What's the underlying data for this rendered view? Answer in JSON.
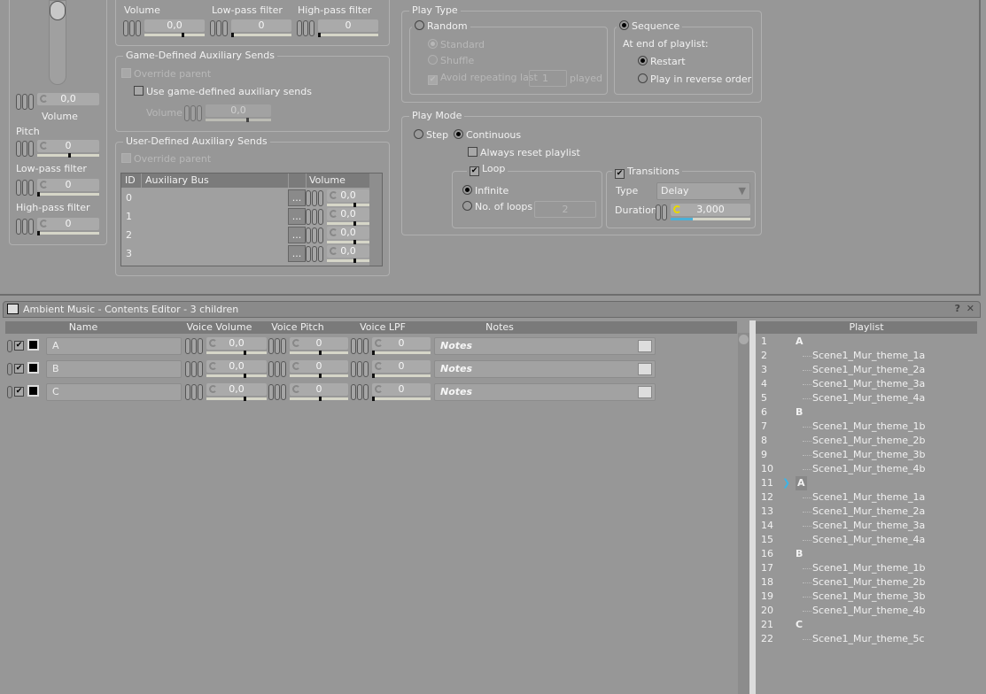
{
  "left_column": {
    "volume_value": "0,0",
    "volume_label": "Volume",
    "pitch_label": "Pitch",
    "pitch_value": "0",
    "lpf_label": "Low-pass filter",
    "lpf_value": "0",
    "hpf_label": "High-pass filter",
    "hpf_value": "0"
  },
  "output": {
    "volume_label": "Volume",
    "volume_value": "0,0",
    "lpf_label": "Low-pass filter",
    "lpf_value": "0",
    "hpf_label": "High-pass filter",
    "hpf_value": "0"
  },
  "game_aux": {
    "title": "Game-Defined Auxiliary Sends",
    "override": "Override parent",
    "use_label": "Use game-defined auxiliary sends",
    "volume_label": "Volume",
    "volume_value": "0,0"
  },
  "user_aux": {
    "title": "User-Defined Auxiliary Sends",
    "override": "Override parent",
    "columns": [
      "ID",
      "Auxiliary Bus",
      "",
      "Volume"
    ],
    "rows": [
      {
        "id": "0",
        "bus": "",
        "volume": "0,0"
      },
      {
        "id": "1",
        "bus": "",
        "volume": "0,0"
      },
      {
        "id": "2",
        "bus": "",
        "volume": "0,0"
      },
      {
        "id": "3",
        "bus": "",
        "volume": "0,0"
      }
    ],
    "browse_label": "..."
  },
  "play_type": {
    "title": "Play Type",
    "random": "Random",
    "standard": "Standard",
    "shuffle": "Shuffle",
    "avoid": "Avoid repeating last",
    "avoid_value": "1",
    "played": "played",
    "sequence": "Sequence",
    "at_end": "At end of playlist:",
    "restart": "Restart",
    "reverse": "Play in reverse order",
    "selected": "Sequence"
  },
  "play_mode": {
    "title": "Play Mode",
    "step": "Step",
    "continuous": "Continuous",
    "always_reset": "Always reset playlist",
    "loop": "Loop",
    "infinite": "Infinite",
    "loops": "No. of loops",
    "loops_value": "2",
    "transitions": "Transitions",
    "type_label": "Type",
    "type_value": "Delay",
    "duration_label": "Duration",
    "duration_value": "3,000",
    "duration_fraction": 0.28
  },
  "editor": {
    "title": "Ambient Music - Contents Editor - 3 children",
    "help": "?",
    "close": "✕",
    "columns": [
      "Name",
      "Voice Volume",
      "Voice Pitch",
      "Voice LPF",
      "Notes"
    ],
    "rows": [
      {
        "name": "A",
        "volume": "0,0",
        "pitch": "0",
        "lpf": "0",
        "notes": "Notes"
      },
      {
        "name": "B",
        "volume": "0,0",
        "pitch": "0",
        "lpf": "0",
        "notes": "Notes"
      },
      {
        "name": "C",
        "volume": "0,0",
        "pitch": "0",
        "lpf": "0",
        "notes": "Notes"
      }
    ]
  },
  "playlist": {
    "header": "Playlist",
    "accent": "#3cb4e6",
    "items": [
      {
        "n": "1",
        "group": "A"
      },
      {
        "n": "2",
        "child": "Scene1_Mur_theme_1a"
      },
      {
        "n": "3",
        "child": "Scene1_Mur_theme_2a"
      },
      {
        "n": "4",
        "child": "Scene1_Mur_theme_3a"
      },
      {
        "n": "5",
        "child": "Scene1_Mur_theme_4a"
      },
      {
        "n": "6",
        "group": "B"
      },
      {
        "n": "7",
        "child": "Scene1_Mur_theme_1b"
      },
      {
        "n": "8",
        "child": "Scene1_Mur_theme_2b"
      },
      {
        "n": "9",
        "child": "Scene1_Mur_theme_3b"
      },
      {
        "n": "10",
        "child": "Scene1_Mur_theme_4b"
      },
      {
        "n": "11",
        "group": "A",
        "current": true
      },
      {
        "n": "12",
        "child": "Scene1_Mur_theme_1a"
      },
      {
        "n": "13",
        "child": "Scene1_Mur_theme_2a"
      },
      {
        "n": "14",
        "child": "Scene1_Mur_theme_3a"
      },
      {
        "n": "15",
        "child": "Scene1_Mur_theme_4a"
      },
      {
        "n": "16",
        "group": "B"
      },
      {
        "n": "17",
        "child": "Scene1_Mur_theme_1b"
      },
      {
        "n": "18",
        "child": "Scene1_Mur_theme_2b"
      },
      {
        "n": "19",
        "child": "Scene1_Mur_theme_3b"
      },
      {
        "n": "20",
        "child": "Scene1_Mur_theme_4b"
      },
      {
        "n": "21",
        "group": "C"
      },
      {
        "n": "22",
        "child": "Scene1_Mur_theme_5c"
      }
    ]
  }
}
